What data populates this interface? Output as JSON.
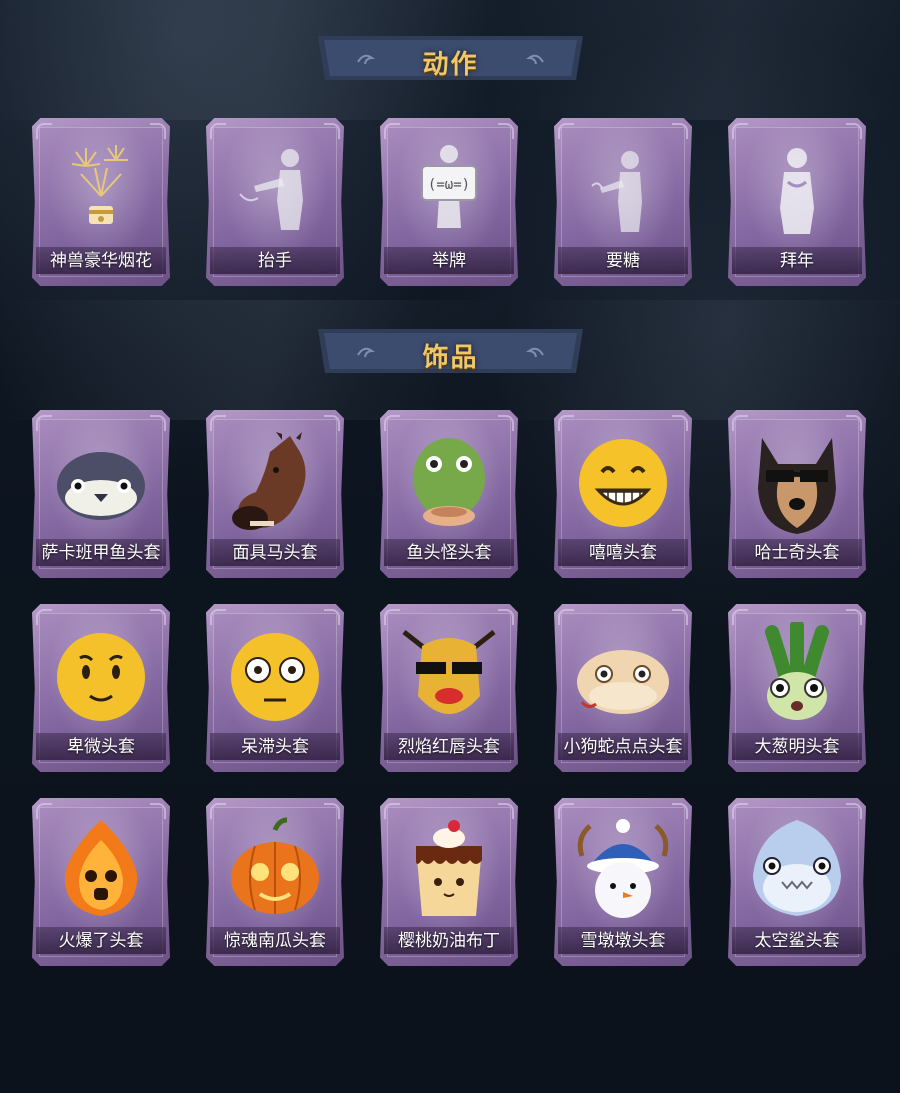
{
  "sections": {
    "actions": {
      "title": "动作",
      "items": [
        {
          "label": "神兽豪华烟花",
          "icon": "fireworks-icon"
        },
        {
          "label": "抬手",
          "icon": "raise-hand-icon"
        },
        {
          "label": "举牌",
          "icon": "hold-sign-icon"
        },
        {
          "label": "要糖",
          "icon": "ask-candy-icon"
        },
        {
          "label": "拜年",
          "icon": "new-year-greeting-icon"
        }
      ]
    },
    "accessories": {
      "title": "饰品",
      "items": [
        {
          "label": "萨卡班甲鱼头套",
          "icon": "fish-head-icon"
        },
        {
          "label": "面具马头套",
          "icon": "horse-mask-icon"
        },
        {
          "label": "鱼头怪头套",
          "icon": "fish-monster-icon"
        },
        {
          "label": "嘻嘻头套",
          "icon": "grin-emoji-icon"
        },
        {
          "label": "哈士奇头套",
          "icon": "husky-icon"
        },
        {
          "label": "卑微头套",
          "icon": "humble-emoji-icon"
        },
        {
          "label": "呆滞头套",
          "icon": "stunned-emoji-icon"
        },
        {
          "label": "烈焰红唇头套",
          "icon": "red-lips-icon"
        },
        {
          "label": "小狗蛇点点头套",
          "icon": "snake-icon"
        },
        {
          "label": "大葱明头套",
          "icon": "scallion-icon"
        },
        {
          "label": "火爆了头套",
          "icon": "fire-sprite-icon"
        },
        {
          "label": "惊魂南瓜头套",
          "icon": "pumpkin-icon"
        },
        {
          "label": "樱桃奶油布丁",
          "icon": "pudding-icon"
        },
        {
          "label": "雪墩墩头套",
          "icon": "snowman-icon"
        },
        {
          "label": "太空鲨头套",
          "icon": "space-shark-icon"
        }
      ]
    }
  },
  "colors": {
    "background": "#0e1622",
    "title_gold": "#f0c86a",
    "card_purple": "#8d6fa6",
    "banner_blue": "#3a4a6a"
  }
}
